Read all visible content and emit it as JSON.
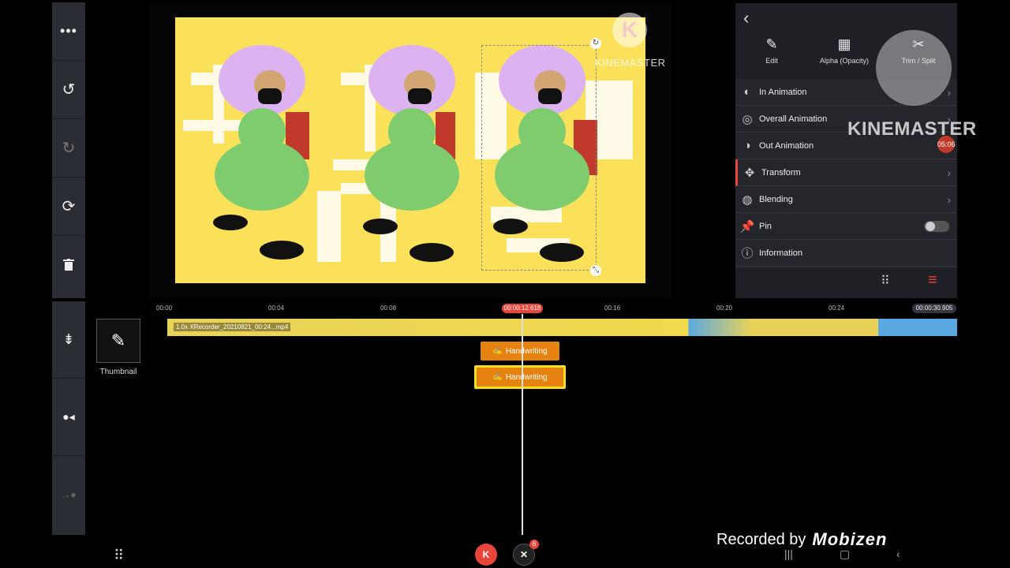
{
  "colors": {
    "accent": "#e9453a",
    "panel": "#24262b",
    "clip": "#e6820f",
    "canvas": "#fbe15a"
  },
  "left_toolbar": {
    "top_icons": [
      "more-icon",
      "undo-icon",
      "redo-icon",
      "replay-icon",
      "trash-icon"
    ],
    "bottom_icons": [
      "split-track-icon",
      "record-dot-icon",
      "track-end-icon"
    ]
  },
  "preview": {
    "watermark_text": "KINEMASTER",
    "watermark_letter": "K"
  },
  "panel": {
    "tools": [
      {
        "label": "Edit",
        "icon": "pen-icon"
      },
      {
        "label": "Alpha (Opacity)",
        "icon": "checker-icon"
      },
      {
        "label": "Trim / Split",
        "icon": "scissors-icon"
      }
    ],
    "menu": [
      {
        "label": "In Animation",
        "icon": "in-animation-icon"
      },
      {
        "label": "Overall Animation",
        "icon": "overall-animation-icon"
      },
      {
        "label": "Out Animation",
        "icon": "out-animation-icon"
      },
      {
        "label": "Transform",
        "icon": "transform-icon"
      },
      {
        "label": "Blending",
        "icon": "blending-icon"
      },
      {
        "label": "Pin",
        "icon": "pin-icon"
      },
      {
        "label": "Information",
        "icon": "info-icon"
      }
    ],
    "overlay_brand": "KINEMASTER",
    "overlay_time": "05:06"
  },
  "timeline": {
    "ticks": [
      "00:00",
      "00:04",
      "00:08",
      "00:16",
      "00:20",
      "00:24"
    ],
    "current_time": "00:00:12.618",
    "end_time": "00:00:30.905",
    "video_clip_label": "1.0x XRecorder_20210821_00:24...mp4",
    "layers": [
      {
        "label": "Handwriting",
        "selected": false
      },
      {
        "label": "Handwriting",
        "selected": true
      }
    ],
    "thumbnail_label": "Thumbnail"
  },
  "bottom": {
    "recorded_by": "Recorded by",
    "recorder_brand": "Mobizen",
    "app_badge": "6"
  }
}
